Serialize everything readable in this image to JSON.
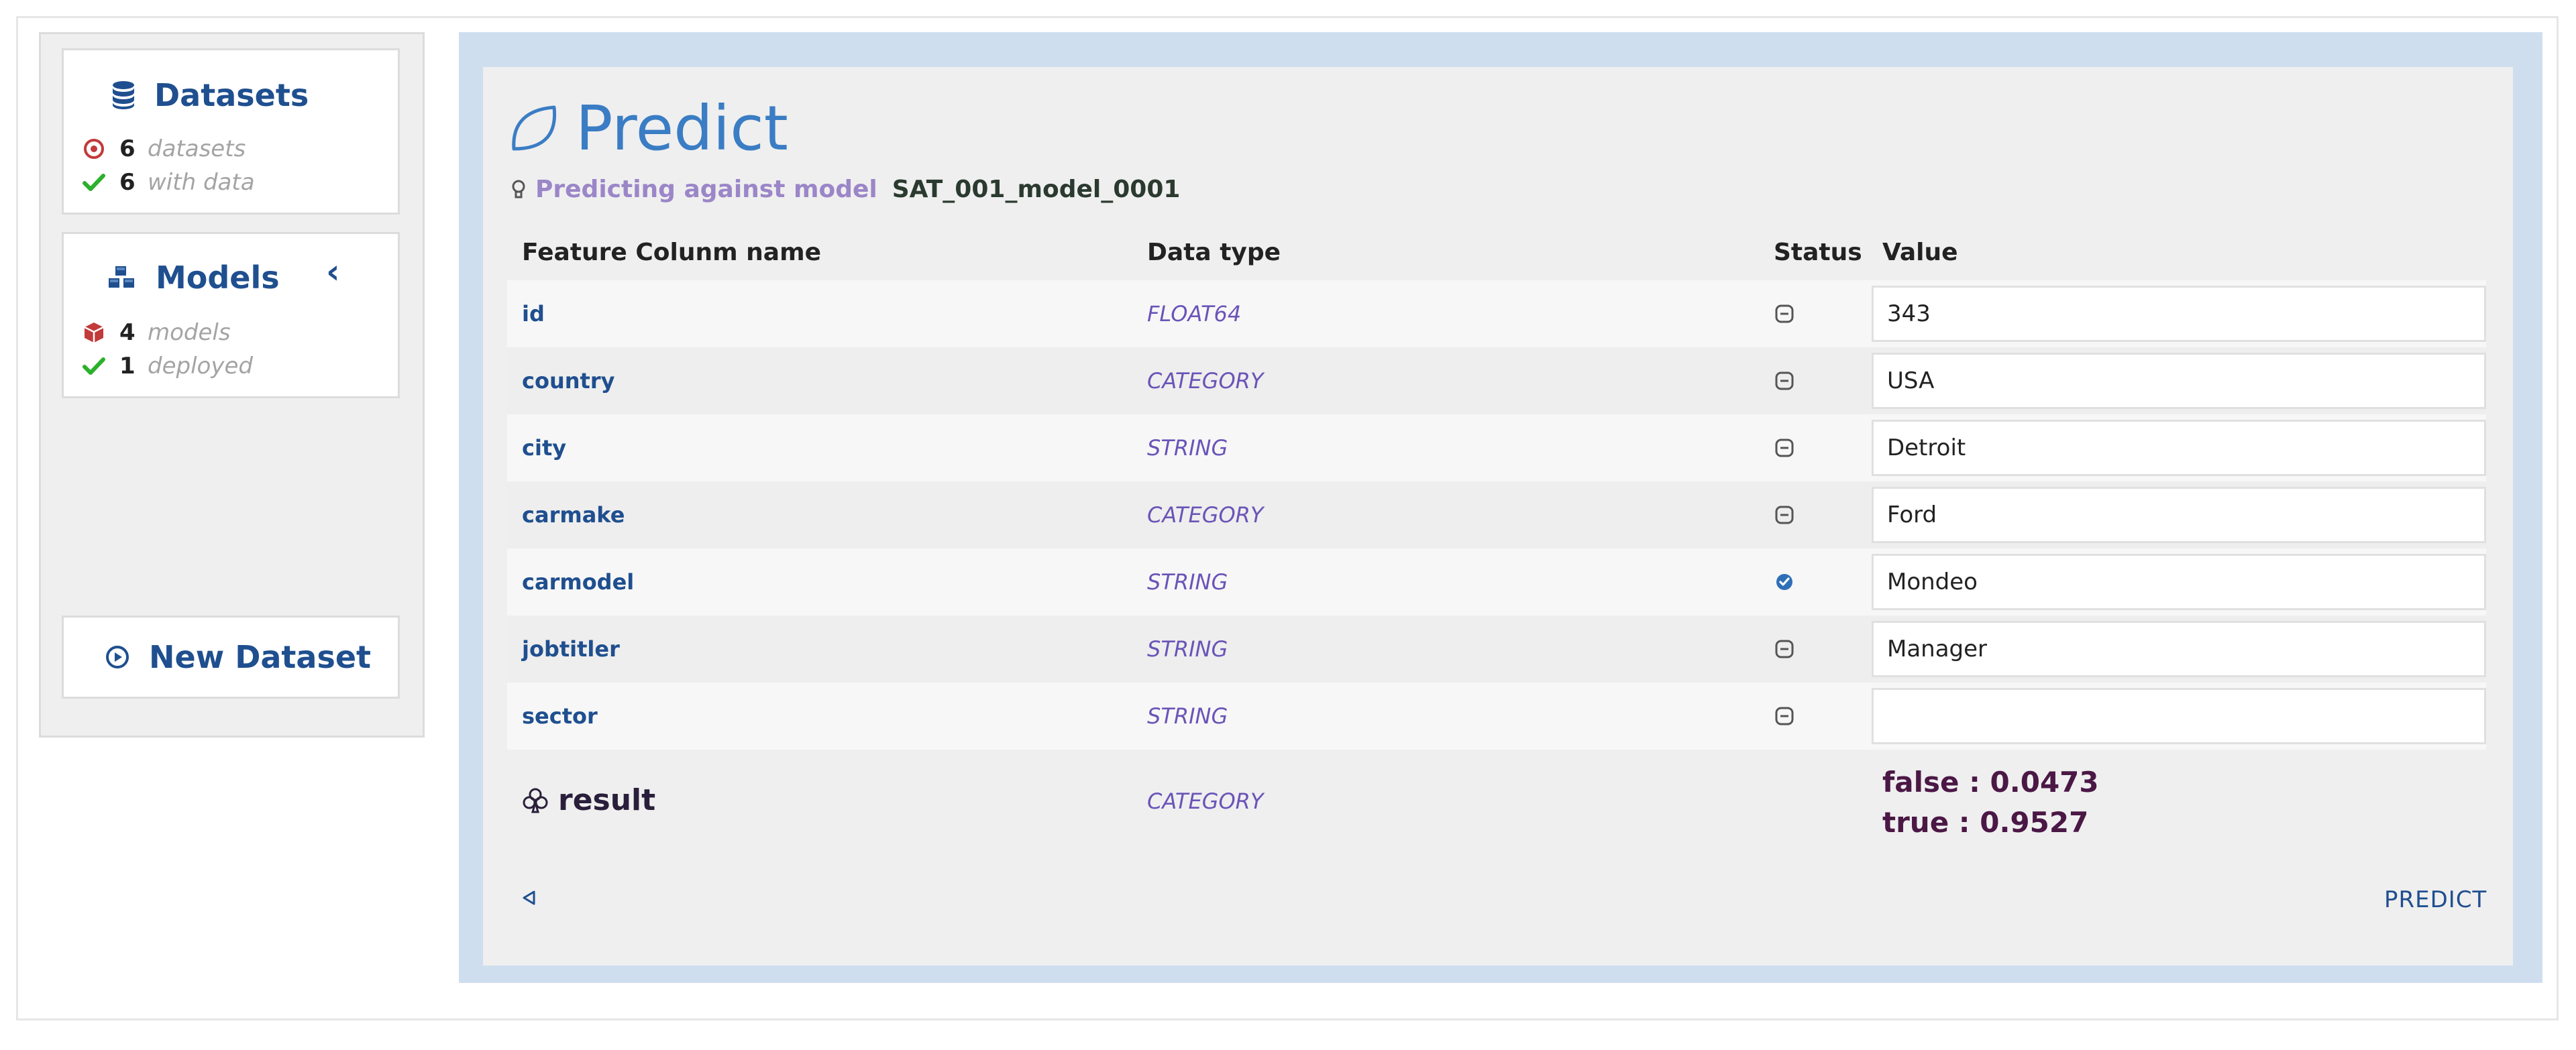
{
  "sidebar": {
    "datasets": {
      "title": "Datasets",
      "count": "6",
      "count_label": "datasets",
      "with_data": "6",
      "with_data_label": "with data"
    },
    "models": {
      "title": "Models",
      "count": "4",
      "count_label": "models",
      "deployed": "1",
      "deployed_label": "deployed",
      "collapse_glyph": "‹"
    },
    "new_dataset_label": "New Dataset"
  },
  "predict": {
    "title": "Predict",
    "subtitle_prefix": "Predicting against model",
    "model_name": "SAT_001_model_0001",
    "columns": {
      "name": "Feature Colunm name",
      "type": "Data type",
      "status": "Status",
      "value": "Value"
    },
    "rows": [
      {
        "name": "id",
        "type": "FLOAT64",
        "status": "unset",
        "value": "343"
      },
      {
        "name": "country",
        "type": "CATEGORY",
        "status": "unset",
        "value": "USA"
      },
      {
        "name": "city",
        "type": "STRING",
        "status": "unset",
        "value": "Detroit"
      },
      {
        "name": "carmake",
        "type": "CATEGORY",
        "status": "unset",
        "value": "Ford"
      },
      {
        "name": "carmodel",
        "type": "STRING",
        "status": "ok",
        "value": "Mondeo"
      },
      {
        "name": "jobtitler",
        "type": "STRING",
        "status": "unset",
        "value": "Manager"
      },
      {
        "name": "sector",
        "type": "STRING",
        "status": "unset",
        "value": ""
      }
    ],
    "result": {
      "name": "result",
      "type": "CATEGORY",
      "lines": [
        "false : 0.0473",
        "true : 0.9527"
      ]
    },
    "predict_label": "PREDICT"
  },
  "colors": {
    "accent_blue": "#1f4f8f",
    "title_blue": "#3a7dc4",
    "panel_border": "#cfdeef",
    "type_purple": "#6a54b8",
    "result_color": "#4b1846",
    "ok_green": "#2bb02b",
    "alert_red": "#c23a3a"
  },
  "icons": {
    "datasets": "database-icon",
    "models": "cubes-icon",
    "new_dataset": "play-circle-icon",
    "predict": "leaf-icon",
    "model_hint": "lightbulb-icon",
    "status_unset": "minus-square-icon",
    "status_ok": "check-circle-icon",
    "result": "club-icon",
    "back": "triangle-left-icon"
  }
}
